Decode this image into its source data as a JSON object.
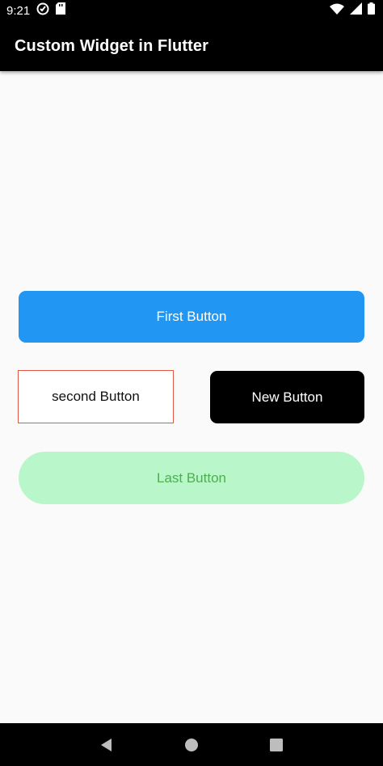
{
  "status_bar": {
    "time": "9:21",
    "icons": [
      "vpn-icon",
      "sd-card-icon",
      "wifi-icon",
      "signal-icon",
      "battery-icon"
    ]
  },
  "app_bar": {
    "title": "Custom Widget in Flutter"
  },
  "buttons": {
    "first": {
      "label": "First Button",
      "background": "#2196f3",
      "text_color": "#ffffff"
    },
    "second": {
      "label": "second Button",
      "background": "#ffffff",
      "border_color": "#e05a43",
      "text_color": "#111111"
    },
    "new": {
      "label": "New Button",
      "background": "#000000",
      "text_color": "#ffffff"
    },
    "last": {
      "label": "Last Button",
      "background": "#b9f6ca",
      "text_color": "#4caf50"
    }
  },
  "nav_bar": {
    "items": [
      "back-icon",
      "home-icon",
      "recents-icon"
    ]
  }
}
